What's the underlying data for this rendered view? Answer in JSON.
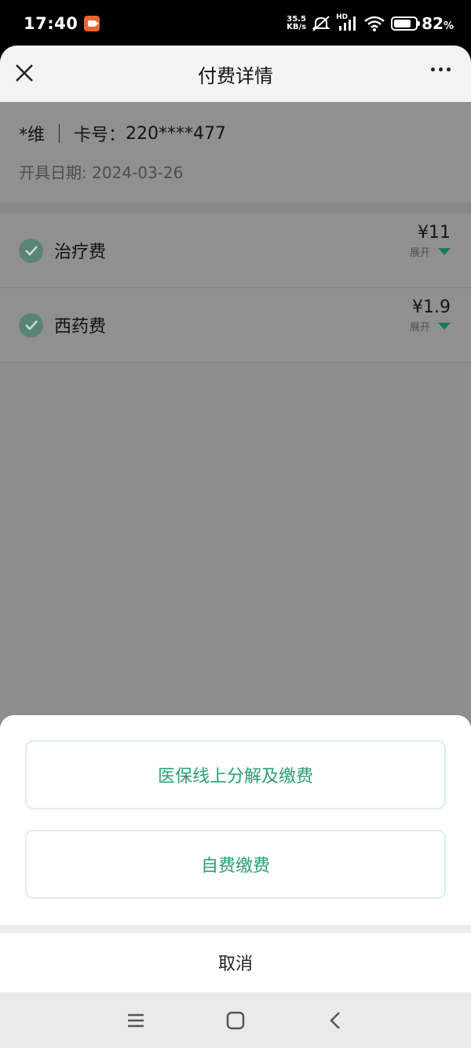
{
  "status_bar": {
    "time": "17:40",
    "net_speed_value": "35.5",
    "net_speed_unit": "KB/s",
    "hd_label": "HD",
    "battery_percent": "82",
    "battery_suffix": "%"
  },
  "nav": {
    "title": "付费详情"
  },
  "patient": {
    "name": "*维",
    "card_label": "卡号",
    "card_separator": "：",
    "card_number": "220****477",
    "date_label": "开具日期: ",
    "date_value": "2024-03-26"
  },
  "fees": [
    {
      "name": "治疗费",
      "amount": "¥11",
      "expand_label": "展开"
    },
    {
      "name": "西药费",
      "amount": "¥1.9",
      "expand_label": "展开"
    }
  ],
  "action_sheet": {
    "option1": "医保线上分解及缴费",
    "option2": "自费缴费",
    "cancel": "取消"
  },
  "colors": {
    "accent": "#2a9d79",
    "check_bg": "#5a8574"
  }
}
